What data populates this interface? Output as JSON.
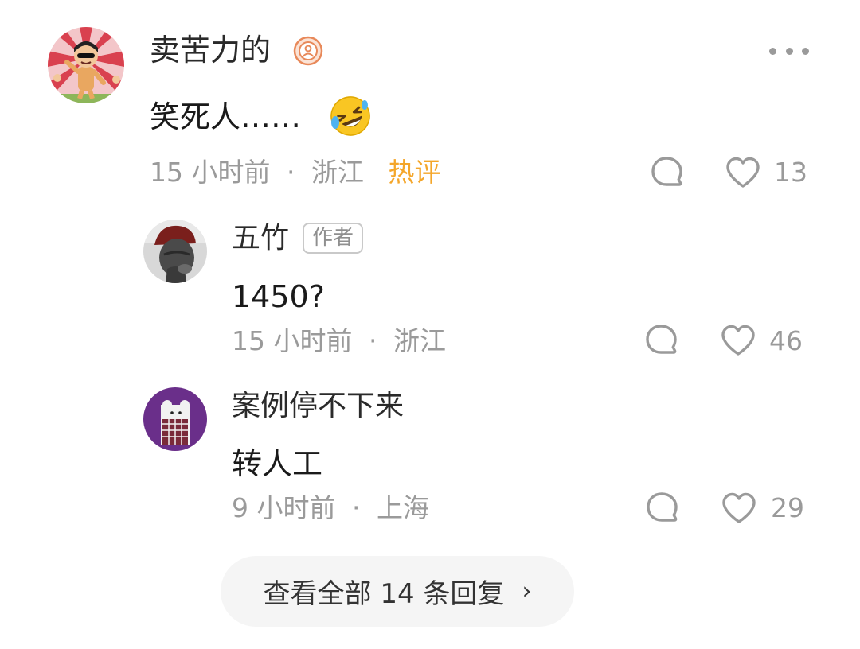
{
  "comment": {
    "username": "卖苦力的",
    "badge_icon": "user-badge-icon",
    "text": "笑死人……",
    "emoji": "rolling-laughing-emoji",
    "time": "15 小时前",
    "separator": "·",
    "location": "浙江",
    "hot_label": "热评",
    "likes": "13",
    "more_icon": "more-dots-icon"
  },
  "replies": [
    {
      "username": "五竹",
      "tag": "作者",
      "text": "1450?",
      "time": "15 小时前",
      "separator": "·",
      "location": "浙江",
      "likes": "46"
    },
    {
      "username": "案例停不下来",
      "text": "转人工",
      "time": "9 小时前",
      "separator": "·",
      "location": "上海",
      "likes": "29"
    }
  ],
  "view_all": {
    "label": "查看全部 14 条回复",
    "chevron": "›"
  },
  "colors": {
    "hot": "#f4a62a",
    "meta": "#9a9a9a",
    "badge": "#e8895a"
  }
}
